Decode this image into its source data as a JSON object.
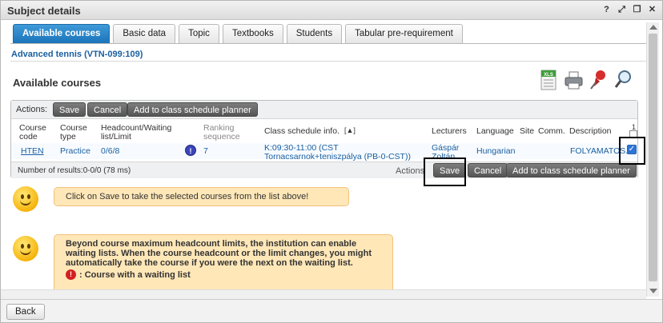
{
  "window": {
    "title": "Subject details",
    "icons": [
      "help-icon",
      "popout-icon",
      "restore-icon",
      "close-icon"
    ]
  },
  "tabs": [
    {
      "label": "Available courses",
      "active": true
    },
    {
      "label": "Basic data"
    },
    {
      "label": "Topic"
    },
    {
      "label": "Textbooks"
    },
    {
      "label": "Students"
    },
    {
      "label": "Tabular pre-requirement"
    }
  ],
  "subject": "Advanced tennis (VTN-099:109)",
  "section_title": "Available courses",
  "actions": {
    "label": "Actions:",
    "save": "Save",
    "cancel": "Cancel",
    "add": "Add to class schedule planner"
  },
  "table": {
    "headers": {
      "code": "Course code",
      "type": "Course type",
      "headcount": "Headcount/Waiting list/Limit",
      "ranking": "Ranking sequence",
      "schedule": "Class schedule info.",
      "lecturers": "Lecturers",
      "language": "Language",
      "site": "Site",
      "comm": "Comm.",
      "description": "Description",
      "check_count": "1"
    },
    "rows": [
      {
        "code": "HTEN",
        "type": "Practice",
        "headcount": "0/6/8",
        "ranking": "7",
        "schedule": "K:09:30-11:00 (CST Tornacsarnok+teniszpálya (PB-0-CST))",
        "lecturers": "Gáspár Zoltán",
        "language": "Hungarian",
        "description": "FOLYAMATOS...",
        "checked": true
      }
    ]
  },
  "footer": {
    "results": "Number of results:0-0/0 (78 ms)",
    "actions_label": "Actions",
    "save": "Save",
    "cancel": "Cancel",
    "add": "Add to class schedule planner"
  },
  "tip1": "Click on Save to take the selected courses from the list above!",
  "tip2": "Beyond course maximum headcount limits, the institution can enable waiting lists. When the course headcount or the limit changes, you might automatically take the course if you were the next on the waiting list.",
  "tip2_legend": ": Course with a waiting list",
  "back": "Back"
}
